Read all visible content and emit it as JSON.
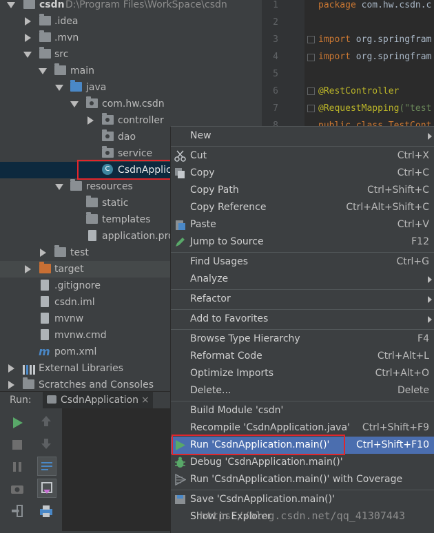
{
  "tree": {
    "root_name": "csdn",
    "root_path": "D:\\Program Files\\WorkSpace\\csdn",
    "idea": ".idea",
    "mvn": ".mvn",
    "src": "src",
    "main": "main",
    "java": "java",
    "package": "com.hw.csdn",
    "controller": "controller",
    "dao": "dao",
    "service": "service",
    "app_class": "CsdnApplic",
    "resources": "resources",
    "static": "static",
    "templates": "templates",
    "app_props": "application.pro",
    "test": "test",
    "target": "target",
    "gitignore": ".gitignore",
    "iml": "csdn.iml",
    "mvnw": "mvnw",
    "mvnw_cmd": "mvnw.cmd",
    "pom": "pom.xml",
    "ext_libs": "External Libraries",
    "scratches": "Scratches and Consoles"
  },
  "editor": {
    "lines": [
      "1",
      "2",
      "3",
      "4",
      "5",
      "6",
      "7",
      "8"
    ],
    "code1_kw": "package",
    "code1_rest": " com.hw.csdn.c",
    "code3_kw": "import",
    "code3_rest": " org.springfram",
    "code4_kw": "import",
    "code4_rest": " org.springfram",
    "code6": "@RestController",
    "code7_ann": "@RequestMapping",
    "code7_str": "(\"test",
    "code8": "public class TestCont"
  },
  "run": {
    "label": "Run:",
    "tab": "CsdnApplication"
  },
  "menu": {
    "new": "New",
    "cut": "Cut",
    "cut_k": "Ctrl+X",
    "copy": "Copy",
    "copy_k": "Ctrl+C",
    "copy_path": "Copy Path",
    "copy_path_k": "Ctrl+Shift+C",
    "copy_ref": "Copy Reference",
    "copy_ref_k": "Ctrl+Alt+Shift+C",
    "paste": "Paste",
    "paste_k": "Ctrl+V",
    "jump": "Jump to Source",
    "jump_k": "F12",
    "find": "Find Usages",
    "find_k": "Ctrl+G",
    "analyze": "Analyze",
    "refactor": "Refactor",
    "favorites": "Add to Favorites",
    "browse": "Browse Type Hierarchy",
    "browse_k": "F4",
    "reformat": "Reformat Code",
    "reformat_k": "Ctrl+Alt+L",
    "optimize": "Optimize Imports",
    "optimize_k": "Ctrl+Alt+O",
    "delete": "Delete...",
    "delete_k": "Delete",
    "build": "Build Module 'csdn'",
    "recompile": "Recompile 'CsdnApplication.java'",
    "recompile_k": "Ctrl+Shift+F9",
    "run": "Run 'CsdnApplication.main()'",
    "run_k": "Ctrl+Shift+F10",
    "debug": "Debug 'CsdnApplication.main()'",
    "coverage": "Run 'CsdnApplication.main()' with Coverage",
    "save": "Save 'CsdnApplication.main()'",
    "show": "Show in Explorer"
  },
  "watermark": "https://blog.csdn.net/qq_41307443",
  "colors": {
    "highlight": "#4b6eaf",
    "selection": "#0d293e",
    "red_box": "#e0262c"
  }
}
